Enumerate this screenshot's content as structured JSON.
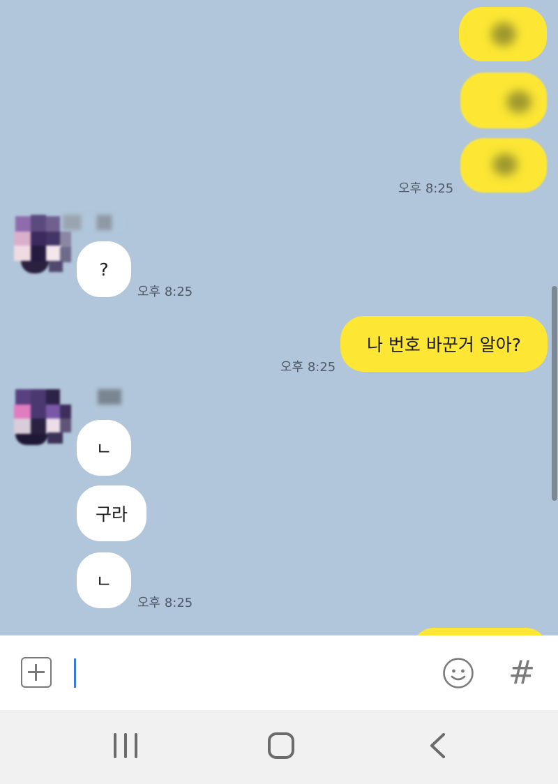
{
  "messages": {
    "time_1": "오후 8:25",
    "question": "?",
    "time_2": "오후 8:25",
    "my_question": "나 번호 바꾼거 알아?",
    "time_3": "오후 8:25",
    "reply_1": "ㄴ",
    "reply_2": "구라",
    "reply_3": "ㄴ",
    "time_4": "오후 8:25"
  },
  "input": {
    "value": ""
  },
  "icons": {
    "attach": "plus-icon",
    "emoticon": "smiley-icon",
    "hashtag": "hash-icon",
    "hashtag_glyph": "#",
    "nav_recent": "recent-apps-icon",
    "nav_home": "home-icon",
    "nav_back": "back-icon"
  },
  "colors": {
    "chat_background": "#b1c6da",
    "my_bubble": "#fde734",
    "their_bubble": "#ffffff",
    "input_bar": "#ffffff",
    "nav_bar": "#f1f1f1"
  }
}
